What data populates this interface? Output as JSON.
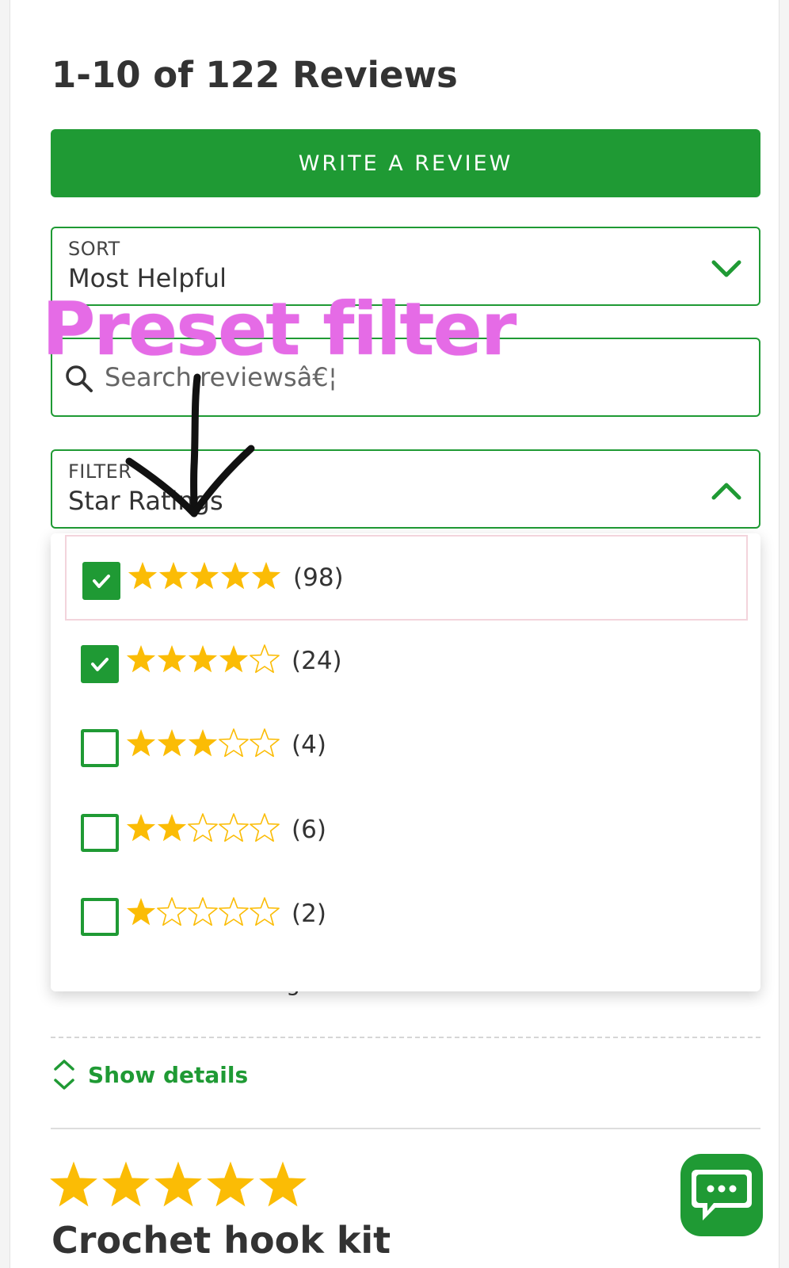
{
  "reviews_header": {
    "title": "1-10 of 122 Reviews"
  },
  "write_review": {
    "label": "WRITE A REVIEW"
  },
  "sort": {
    "label": "SORT",
    "value": "Most Helpful"
  },
  "search": {
    "placeholder": "Search reviewsâ€¦"
  },
  "filter": {
    "label": "FILTER",
    "value": "Star Ratings",
    "expanded": true,
    "options": [
      {
        "stars": 5,
        "count": "(98)",
        "checked": true
      },
      {
        "stars": 4,
        "count": "(24)",
        "checked": true
      },
      {
        "stars": 3,
        "count": "(4)",
        "checked": false
      },
      {
        "stars": 2,
        "count": "(6)",
        "checked": false
      },
      {
        "stars": 1,
        "count": "(2)",
        "checked": false
      }
    ]
  },
  "review_card": {
    "show_details": "Show details",
    "next_rating": 5,
    "next_title": "Crochet hook kit",
    "peek_text": "least when I'm looking."
  },
  "annotation": {
    "text": "Preset filter"
  },
  "icons": {
    "sort_toggle": "chevron-down-icon",
    "filter_toggle": "chevron-up-icon",
    "search": "search-icon",
    "show_details": "expand-collapse-icon",
    "chat": "chat-bubble-icon"
  },
  "colors": {
    "brand_green": "#1f9a34",
    "star_gold": "#fbbc05",
    "annotation_pink": "#e56be6"
  }
}
